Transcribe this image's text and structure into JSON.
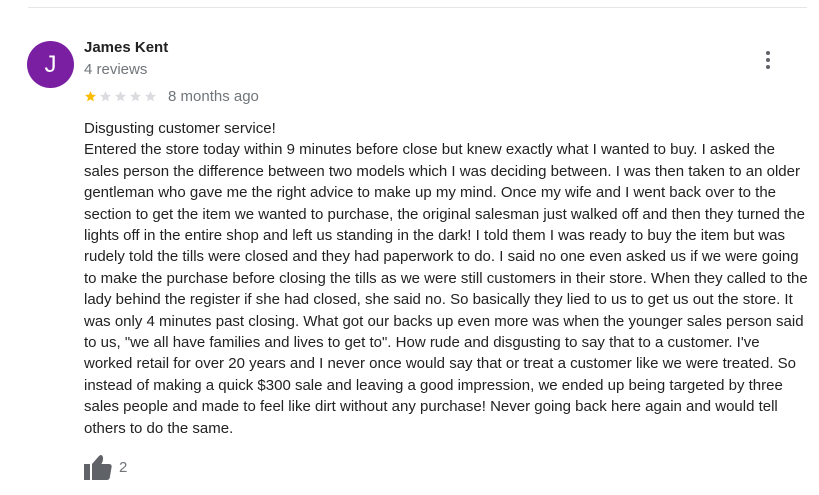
{
  "reviewer": {
    "initial": "J",
    "name": "James Kent",
    "reviews_count": "4 reviews",
    "avatar_color": "#7b1fa2"
  },
  "review": {
    "rating": 1,
    "max_rating": 5,
    "date": "8 months ago",
    "title": "Disgusting customer service!",
    "body": "Entered the store today within 9 minutes before close but knew exactly what I wanted to buy. I asked the sales person the difference between two models which I was deciding between. I was then taken to an older gentleman who gave me the right advice to make up my mind. Once my wife and I went back over to the section to get the item we wanted to purchase, the original salesman just walked off and then they turned the lights off in the entire shop and left us standing in the dark! I told them I was ready to buy the item but was rudely told the tills were closed and they had paperwork to do. I said no one even asked us if we were going to make the purchase before closing the tills as we were still customers in their store. When they called to the lady behind the register if she had closed, she said no. So basically they lied to us to get us out the store. It was only 4 minutes past closing. What got our backs up even more was when the younger sales person said to us, \"we all have families and lives to get to\". How rude and disgusting to say that to a customer. I've worked retail for over 20 years and I never once would say that or treat a customer like we were treated. So instead of making a quick $300 sale and leaving a good impression, we ended up being targeted by three sales people and made to feel like dirt without any purchase! Never going back here again and would tell others to do the same."
  },
  "actions": {
    "like_count": "2",
    "like_icon": "thumbs-up-icon",
    "more_icon": "more-vert-icon"
  },
  "colors": {
    "star_filled": "#fbbc04",
    "star_empty": "#dadce0",
    "secondary_text": "#70757a",
    "icon": "#5f6368"
  }
}
